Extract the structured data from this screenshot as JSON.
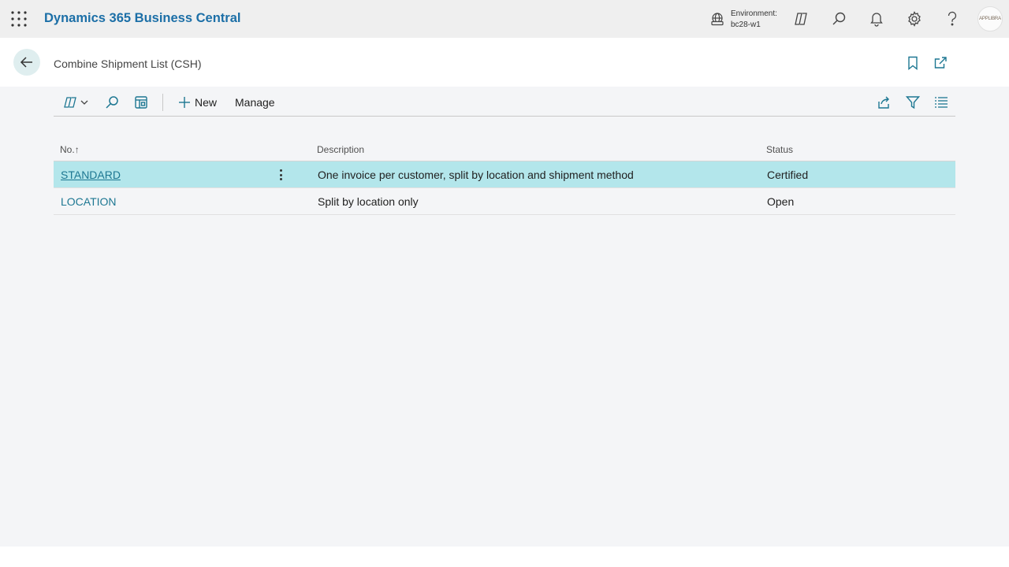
{
  "app": {
    "title": "Dynamics 365 Business Central",
    "environment_label": "Environment:",
    "environment_value": "bc28-w1",
    "avatar_text": "APPLIBRA"
  },
  "page": {
    "title": "Combine Shipment List (CSH)"
  },
  "actionbar": {
    "new_label": "New",
    "manage_label": "Manage"
  },
  "table": {
    "columns": {
      "no": "No.",
      "no_sort_indicator": "↑",
      "description": "Description",
      "status": "Status"
    },
    "rows": [
      {
        "no": "STANDARD",
        "description": "One invoice per customer, split by location and shipment method",
        "status": "Certified"
      },
      {
        "no": "LOCATION",
        "description": "Split by location only",
        "status": "Open"
      }
    ]
  },
  "colors": {
    "brand": "#1c6fa7",
    "accent": "#1d7792",
    "selected_row": "#b3e6eb"
  }
}
